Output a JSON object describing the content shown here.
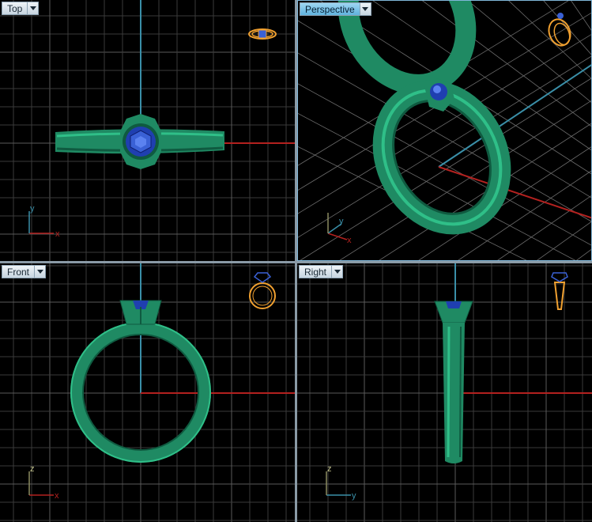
{
  "viewports": {
    "top": {
      "label": "Top",
      "axes": [
        "x",
        "y"
      ]
    },
    "perspective": {
      "label": "Perspective",
      "axes": [
        "x",
        "y"
      ]
    },
    "front": {
      "label": "Front",
      "axes": [
        "x",
        "z"
      ]
    },
    "right": {
      "label": "Right",
      "axes": [
        "y",
        "z"
      ]
    }
  },
  "colors": {
    "grid_minor": "#3a3a3a",
    "grid_major": "#5a5a5a",
    "axis_x": "#b3211f",
    "axis_y": "#3a8fa8",
    "ring_green": "#1f8a63",
    "gem_blue": "#1f3fb0",
    "preview_orange": "#f0a030",
    "active_tab": "#5fb2de"
  },
  "icons": {
    "tab_dropdown": "chevron-down-icon",
    "axis_widget": "axis-triad-icon",
    "preview": "ring-preview-icon"
  }
}
